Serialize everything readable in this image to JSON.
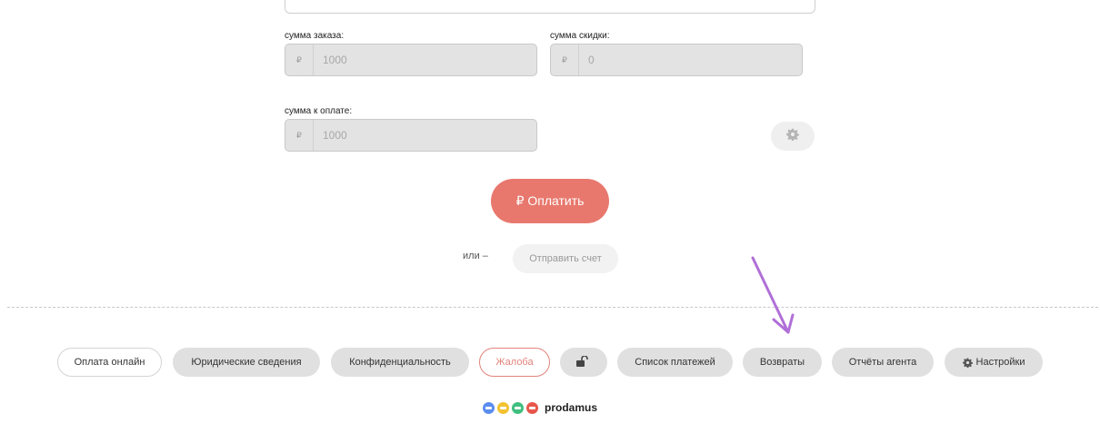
{
  "order": {
    "order_sum_label": "сумма заказа:",
    "currency": "₽",
    "order_sum_value": "1000",
    "discount_label": "сумма скидки:",
    "discount_value": "0",
    "to_pay_label": "сумма к оплате:",
    "to_pay_value": "1000"
  },
  "actions": {
    "pay_label": "₽ Оплатить",
    "or_text": "или –",
    "send_invoice_label": "Отправить счет",
    "settings_icon": "gear-icon"
  },
  "footer": {
    "online_payment": "Оплата онлайн",
    "legal_info": "Юридические сведения",
    "privacy": "Конфиденциальность",
    "complaint": "Жалоба",
    "lock_icon": "unlock-icon",
    "payment_list": "Список платежей",
    "refunds": "Возвраты",
    "agent_reports": "Отчёты агента",
    "settings": "Настройки",
    "brand": "prodamus"
  },
  "colors": {
    "accent": "#e8786d",
    "annotation_arrow": "#b06fd8",
    "logo_blue": "#5b8def",
    "logo_yellow": "#f2c230",
    "logo_green": "#3fbf7f",
    "logo_red": "#e8574a"
  }
}
